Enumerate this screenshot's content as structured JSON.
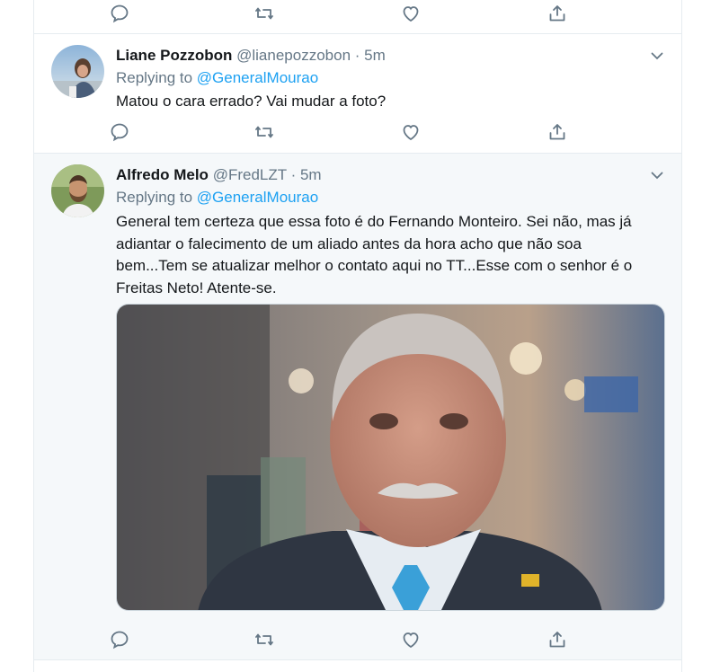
{
  "tweets": [
    {
      "name": "",
      "handle": "",
      "time": "",
      "icons": [
        "reply-icon",
        "retweet-icon",
        "like-icon",
        "share-icon"
      ]
    },
    {
      "name": "Liane Pozzobon",
      "handle": "@lianepozzobon",
      "separator": "·",
      "time": "5m",
      "replying_prefix": "Replying to",
      "replying_to": "@GeneralMourao",
      "text": "Matou o cara errado? Vai mudar a foto?"
    },
    {
      "name": "Alfredo Melo",
      "handle": "@FredLZT",
      "separator": "·",
      "time": "5m",
      "replying_prefix": "Replying to",
      "replying_to": "@GeneralMourao",
      "text_lines": [
        "General tem certeza que essa foto é do Fernando Monteiro. Sei não, mas já",
        "adiantar o falecimento de um aliado antes da hora acho que não soa",
        "bem...Tem se atualizar melhor o contato aqui no TT...Esse com o senhor é o",
        "Freitas Neto! Atente-se."
      ]
    }
  ],
  "colors": {
    "link": "#1da1f2",
    "secondary_text": "#657786",
    "border": "#e6ecf0",
    "highlight_bg": "#f5f8fa"
  }
}
